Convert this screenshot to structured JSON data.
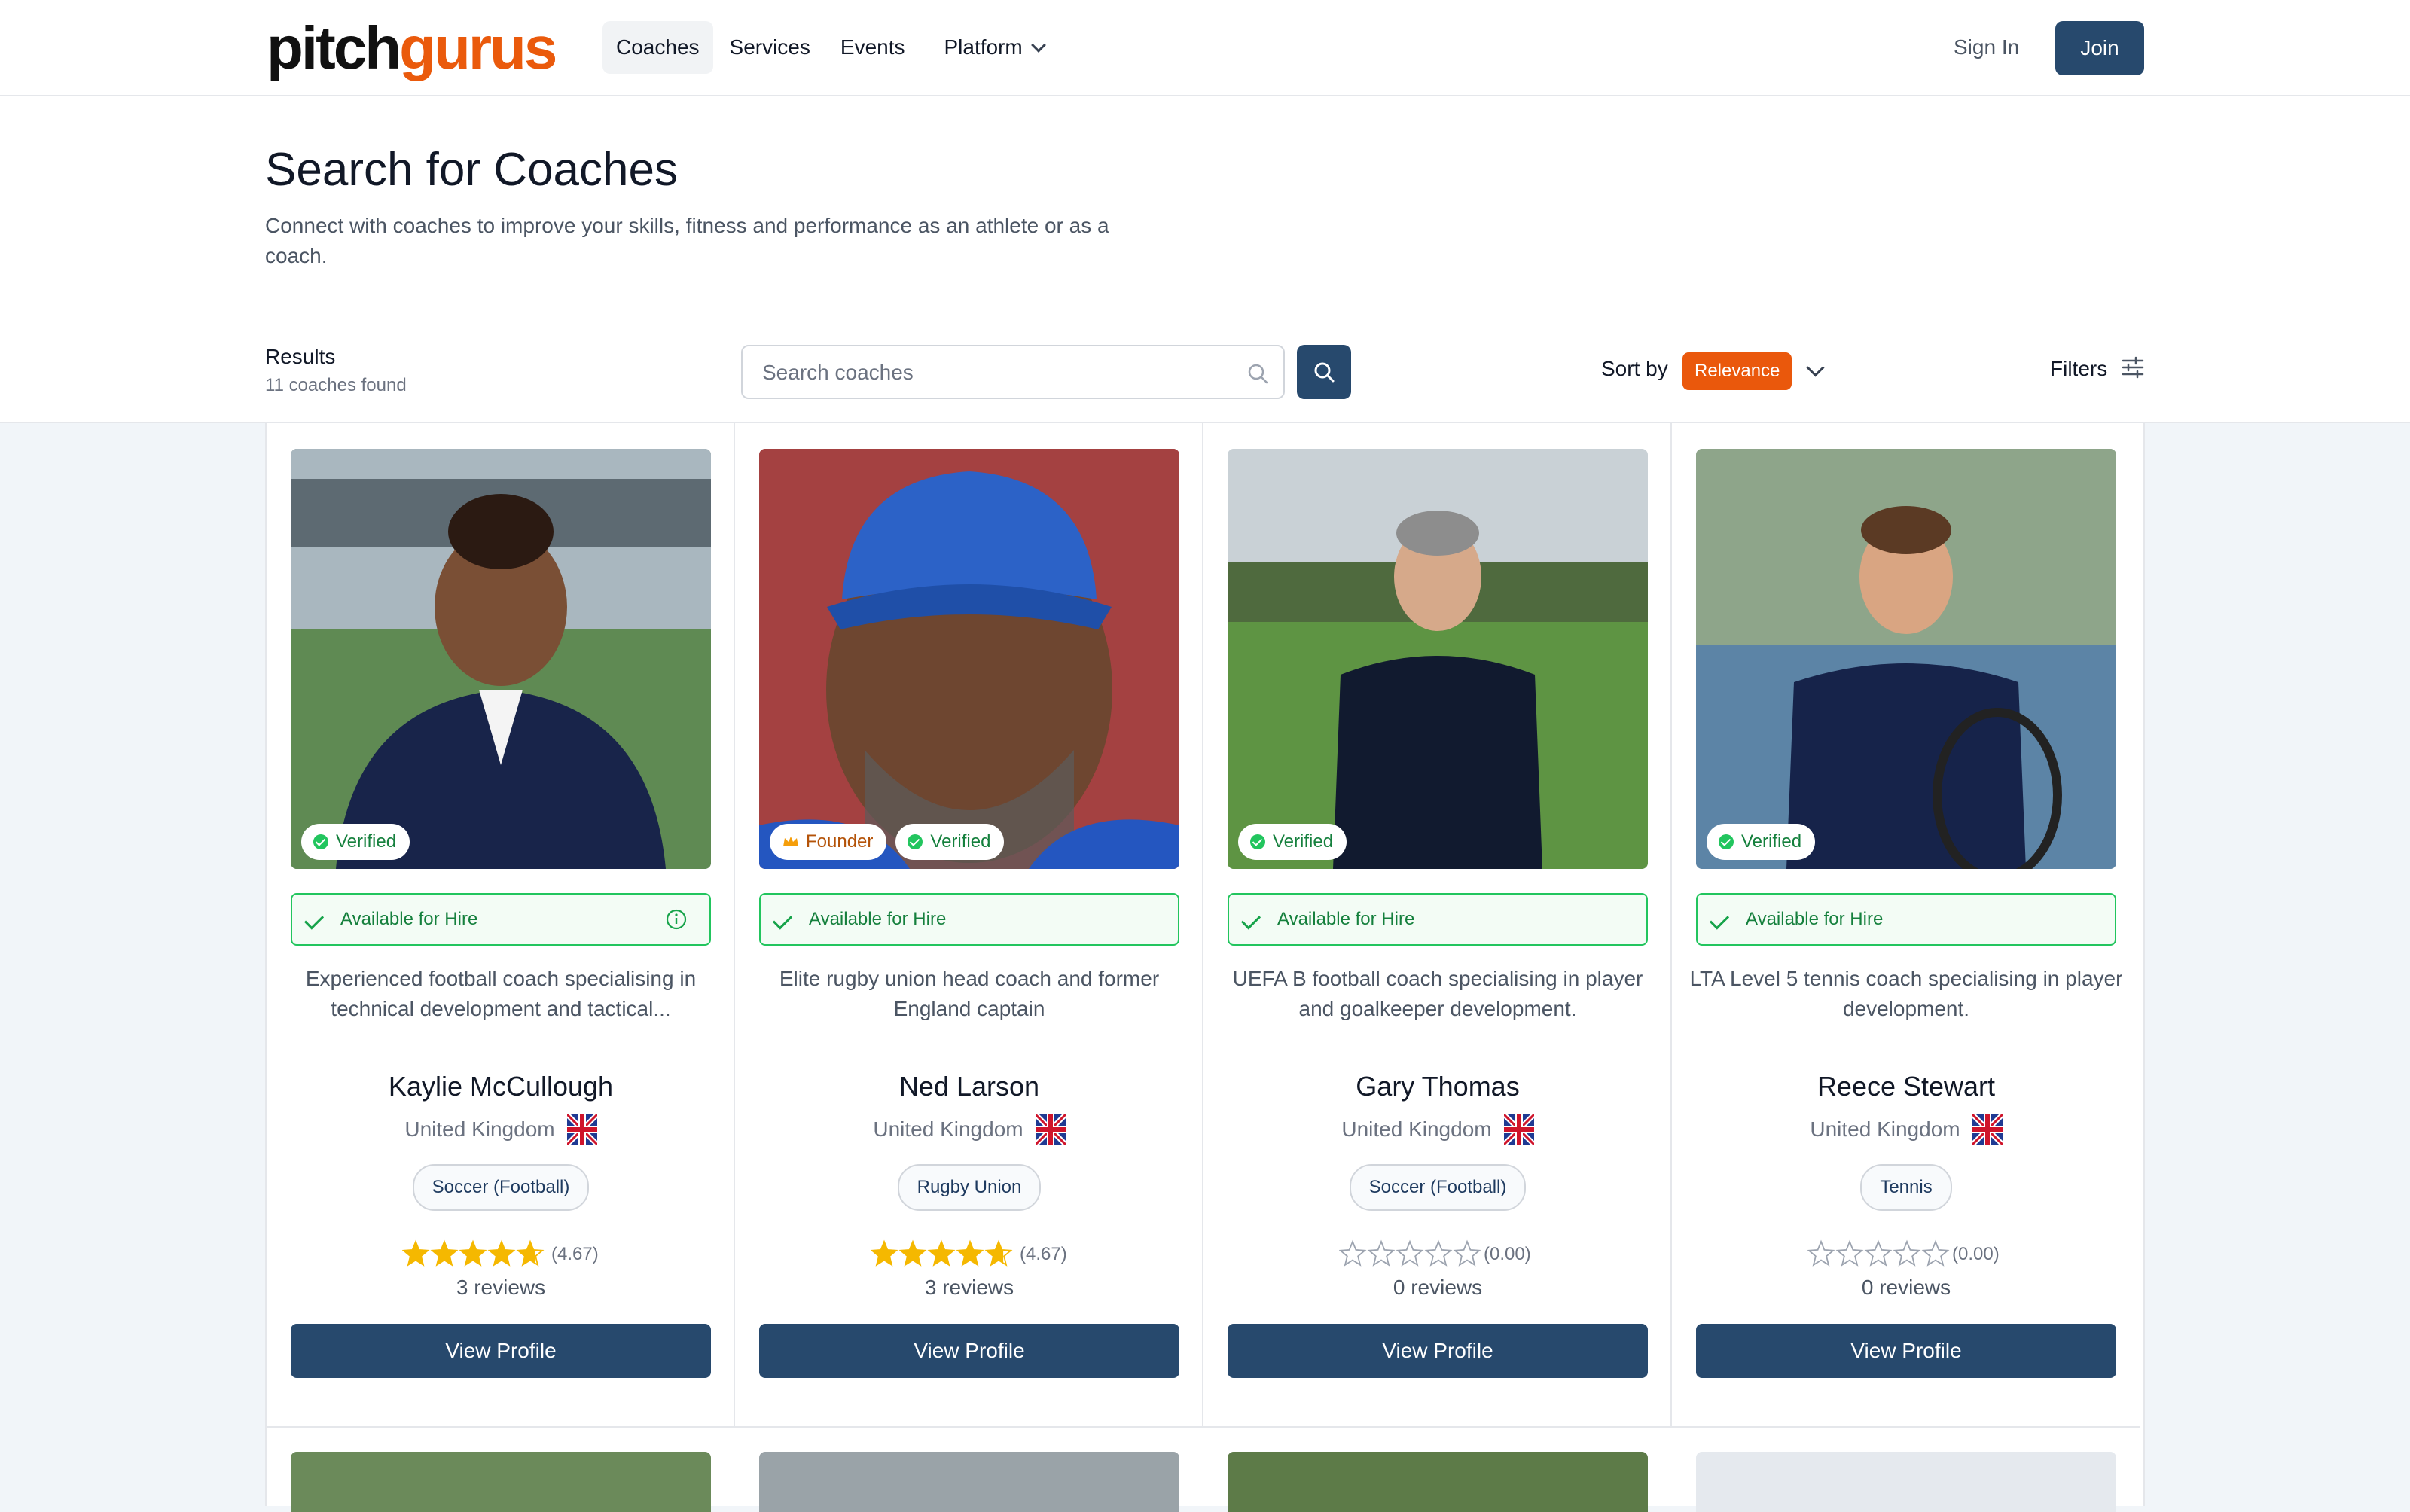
{
  "header": {
    "logo_part1": "pitch",
    "logo_part2": "gurus",
    "nav": [
      "Coaches",
      "Services",
      "Events",
      "Platform"
    ],
    "sign_in": "Sign In",
    "join": "Join"
  },
  "hero": {
    "title": "Search for Coaches",
    "subtitle": "Connect with coaches to improve your skills, fitness and performance as an athlete or as a coach."
  },
  "toolbar": {
    "results_label": "Results",
    "results_count": "11 coaches found",
    "search_placeholder": "Search coaches",
    "sort_label": "Sort by",
    "sort_value": "Relevance",
    "filters_label": "Filters"
  },
  "colors": {
    "brand_orange": "#ea580c",
    "brand_navy": "#27496d",
    "verified_green": "#22c55e",
    "star_gold": "#f5b800"
  },
  "coaches": [
    {
      "name": "Kaylie McCullough",
      "badges": [
        "Verified"
      ],
      "founder": false,
      "availability": "Available for Hire",
      "show_info": true,
      "description": "Experienced football coach specialising in technical development and tactical...",
      "country": "United Kingdom",
      "sport": "Soccer (Football)",
      "rating": 4.67,
      "rating_text": "(4.67)",
      "reviews": "3 reviews",
      "button": "View Profile"
    },
    {
      "name": "Ned Larson",
      "badges": [
        "Founder",
        "Verified"
      ],
      "founder": true,
      "availability": "Available for Hire",
      "show_info": false,
      "description": "Elite rugby union head coach and former England captain",
      "country": "United Kingdom",
      "sport": "Rugby Union",
      "rating": 4.67,
      "rating_text": "(4.67)",
      "reviews": "3 reviews",
      "button": "View Profile"
    },
    {
      "name": "Gary Thomas",
      "badges": [
        "Verified"
      ],
      "founder": false,
      "availability": "Available for Hire",
      "show_info": false,
      "description": "UEFA B football coach specialising in player and goalkeeper development.",
      "country": "United Kingdom",
      "sport": "Soccer (Football)",
      "rating": 0,
      "rating_text": "(0.00)",
      "reviews": "0 reviews",
      "button": "View Profile"
    },
    {
      "name": "Reece Stewart",
      "badges": [
        "Verified"
      ],
      "founder": false,
      "availability": "Available for Hire",
      "show_info": false,
      "description": "LTA Level 5 tennis coach specialising in player development.",
      "country": "United Kingdom",
      "sport": "Tennis",
      "rating": 0,
      "rating_text": "(0.00)",
      "reviews": "0 reviews",
      "button": "View Profile"
    }
  ]
}
